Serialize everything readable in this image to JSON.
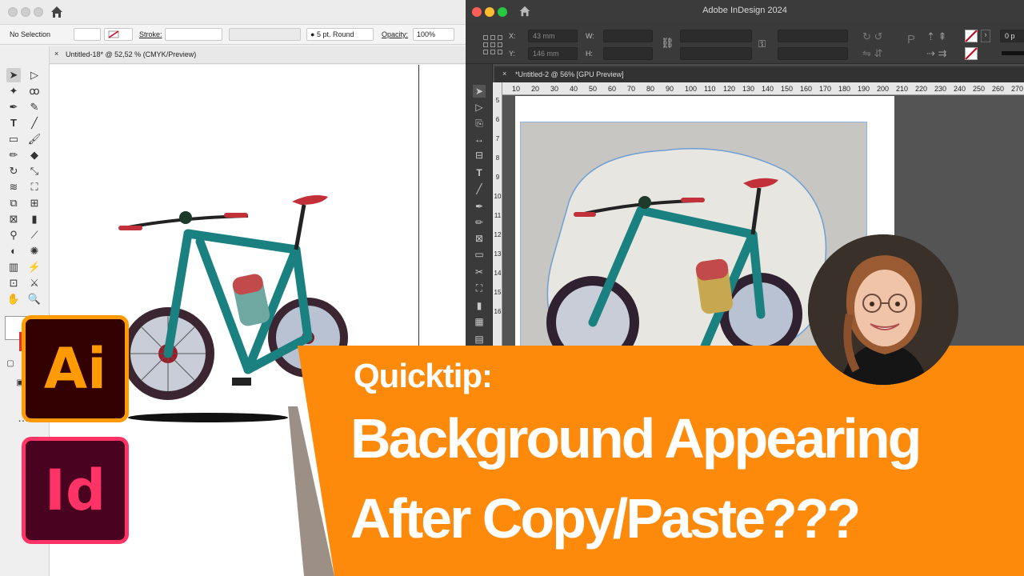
{
  "illustrator": {
    "selection_label": "No Selection",
    "stroke_label": "Stroke:",
    "brush_value": "5 pt. Round",
    "opacity_label": "Opacity:",
    "opacity_value": "100%",
    "tab_title": "Untitled-18* @ 52,52 % (CMYK/Preview)",
    "close_glyph": "×"
  },
  "indesign": {
    "app_title": "Adobe InDesign 2024",
    "x_label": "X:",
    "y_label": "Y:",
    "w_label": "W:",
    "h_label": "H:",
    "x_value": "43 mm",
    "y_value": "146 mm",
    "stroke_value": "0 p",
    "tab_title": "*Untitled-2 @ 56% [GPU Preview]",
    "close_glyph": "×",
    "ruler_ticks": [
      "10",
      "20",
      "30",
      "40",
      "50",
      "60",
      "70",
      "80",
      "90",
      "100",
      "110",
      "120",
      "130",
      "140",
      "150",
      "160",
      "170",
      "180",
      "190",
      "200",
      "210",
      "220",
      "230",
      "240",
      "250",
      "260",
      "270"
    ],
    "vruler_ticks": [
      "5",
      "6",
      "7",
      "8",
      "9",
      "10",
      "11",
      "12",
      "13",
      "14",
      "15",
      "16"
    ]
  },
  "logos": {
    "ai": "Ai",
    "id": "Id"
  },
  "banner": {
    "kicker": "Quicktip:",
    "line1": "Background Appearing",
    "line2": "After Copy/Paste???",
    "color": "#fe8a0c"
  },
  "colors": {
    "bike_frame": "#177a7a",
    "saddle": "#c2313a",
    "ai_accent": "#ff9a00",
    "id_accent": "#ff3366"
  }
}
